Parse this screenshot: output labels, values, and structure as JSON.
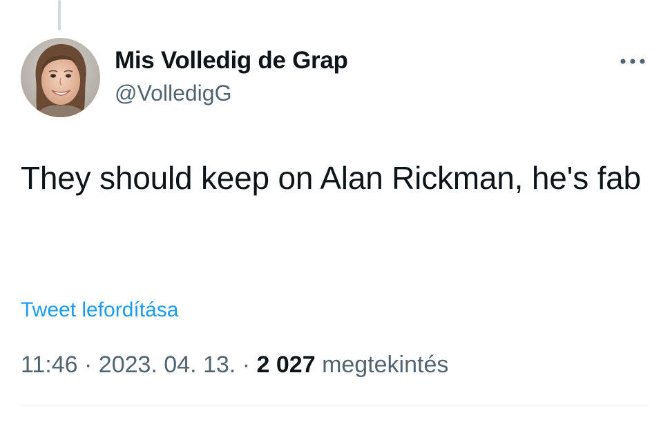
{
  "tweet": {
    "author": {
      "display_name": "Mis Volledig de Grap",
      "handle": "@VolledigG",
      "avatar_icon": "user-avatar-photo"
    },
    "more_icon": "more-horizontal-icon",
    "text": "They should keep on Alan Rickman, he's fab",
    "translate_label": "Tweet lefordítása",
    "meta": {
      "time": "11:46",
      "separator_1": " · ",
      "date": "2023. 04. 13.",
      "separator_2": " · ",
      "views_count": "2 027",
      "views_label": "megtekintés"
    }
  },
  "colors": {
    "text_primary": "#0f1419",
    "text_secondary": "#536471",
    "link": "#1d9bf0",
    "thread_line": "#cfd9de"
  }
}
